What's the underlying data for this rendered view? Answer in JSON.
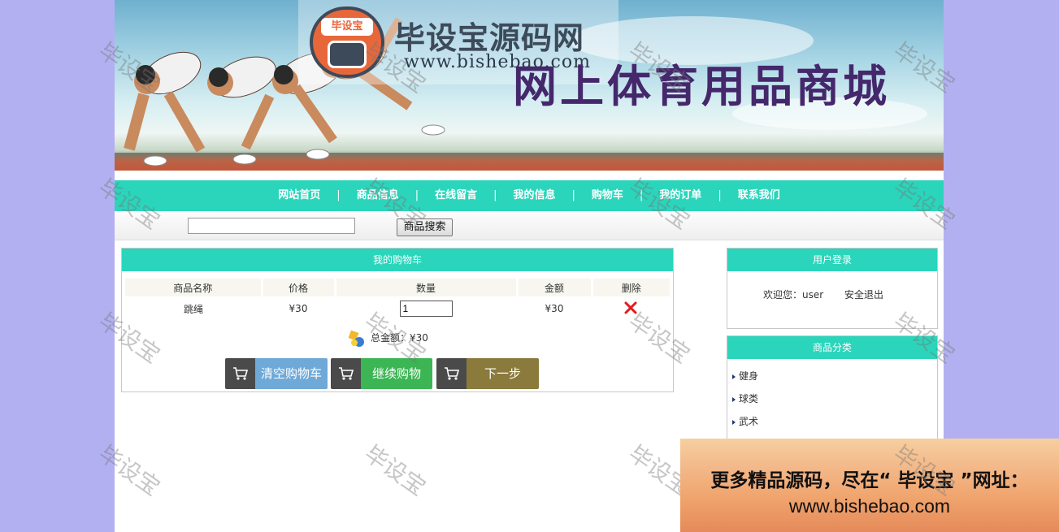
{
  "banner": {
    "logo_badge_text": "毕设宝",
    "logo_name": "毕设宝源码网",
    "logo_url": "www.bishebao.com",
    "site_title": "网上体育用品商城"
  },
  "nav": {
    "items": [
      "网站首页",
      "商品信息",
      "在线留言",
      "我的信息",
      "购物车",
      "我的订单",
      "联系我们"
    ],
    "separator": "|"
  },
  "search": {
    "value": "",
    "button_label": "商品搜索"
  },
  "cart": {
    "title": "我的购物车",
    "columns": [
      "商品名称",
      "价格",
      "数量",
      "金额",
      "删除"
    ],
    "rows": [
      {
        "name": "跳绳",
        "price": "¥30",
        "quantity": "1",
        "amount": "¥30"
      }
    ],
    "total_label": "总金额：¥30",
    "buttons": {
      "clear": "清空购物车",
      "continue": "继续购物",
      "next": "下一步"
    }
  },
  "login": {
    "title": "用户登录",
    "welcome": "欢迎您：user",
    "logout": "安全退出"
  },
  "categories": {
    "title": "商品分类",
    "items": [
      "健身",
      "球类",
      "武术"
    ]
  },
  "watermark": "毕设宝",
  "ad": {
    "line1": "更多精品源码，尽在“ 毕设宝 ”网址：",
    "line2": "www.bishebao.com"
  },
  "colors": {
    "accent": "#2ad5bb",
    "background": "#b3b0f2",
    "title": "#45276b"
  }
}
